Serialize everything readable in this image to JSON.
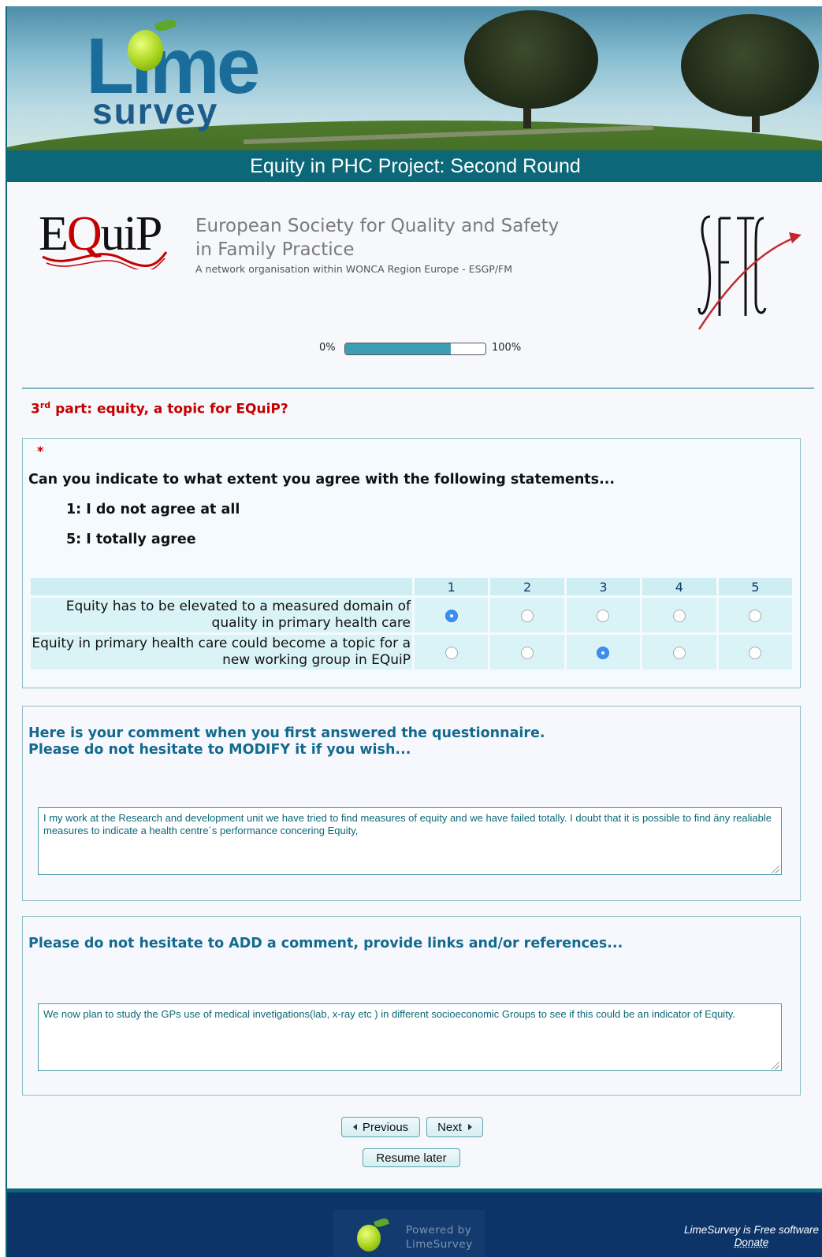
{
  "header": {
    "logo_text_top": "Lime",
    "logo_text_bottom": "survey",
    "title": "Equity in PHC Project: Second Round"
  },
  "logos": {
    "equip_word_e": "E",
    "equip_word_q": "Q",
    "equip_word_rest": "uiP",
    "society_line1": "European Society for Quality and Safety",
    "society_line2": "in Family Practice",
    "society_line3": "A network organisation within WONCA Region Europe - ESGP/FM"
  },
  "progress": {
    "min_label": "0%",
    "max_label": "100%",
    "value_percent": 75
  },
  "group": {
    "title_prefix": "3",
    "title_sup": "rd",
    "title_rest": " part: equity, a topic for EQuiP?"
  },
  "question1": {
    "required_mark": "*",
    "text": "Can you indicate to what extent you agree with the following statements...",
    "scale_low": "1: I do not agree at all",
    "scale_high": "5: I totally agree",
    "columns": [
      "1",
      "2",
      "3",
      "4",
      "5"
    ],
    "rows": [
      {
        "label": "Equity has to be elevated to a measured domain of quality in primary health care",
        "selected": 1
      },
      {
        "label": "Equity in primary health care could become a topic for a new working group in EQuiP",
        "selected": 3
      }
    ]
  },
  "question2": {
    "text_line1": "Here is your comment when you first answered the questionnaire.",
    "text_line2": "Please do not hesitate to MODIFY it if you wish...",
    "value": "I my work at the Research and development unit we have tried to find measures of equity and we have failed totally. I doubt that it is possible to find äny realiable measures to indicate a health centre´s performance concering Equity,"
  },
  "question3": {
    "text": "Please do not hesitate to ADD a comment, provide links and/or references...",
    "value": "We now plan to study the GPs use of medical invetigations(lab, x-ray etc ) in different socioeconomic Groups to see if this could be an indicator of Equity."
  },
  "nav": {
    "previous": "Previous",
    "next": "Next",
    "resume": "Resume later"
  },
  "footer": {
    "powered_line1": "Powered by",
    "powered_line2": "LimeSurvey",
    "free_text": "LimeSurvey is Free software",
    "donate": "Donate"
  },
  "colors": {
    "accent": "#0c6778",
    "group_title": "#c40000",
    "question_blue": "#136a8e",
    "footer": "#0d3468"
  }
}
